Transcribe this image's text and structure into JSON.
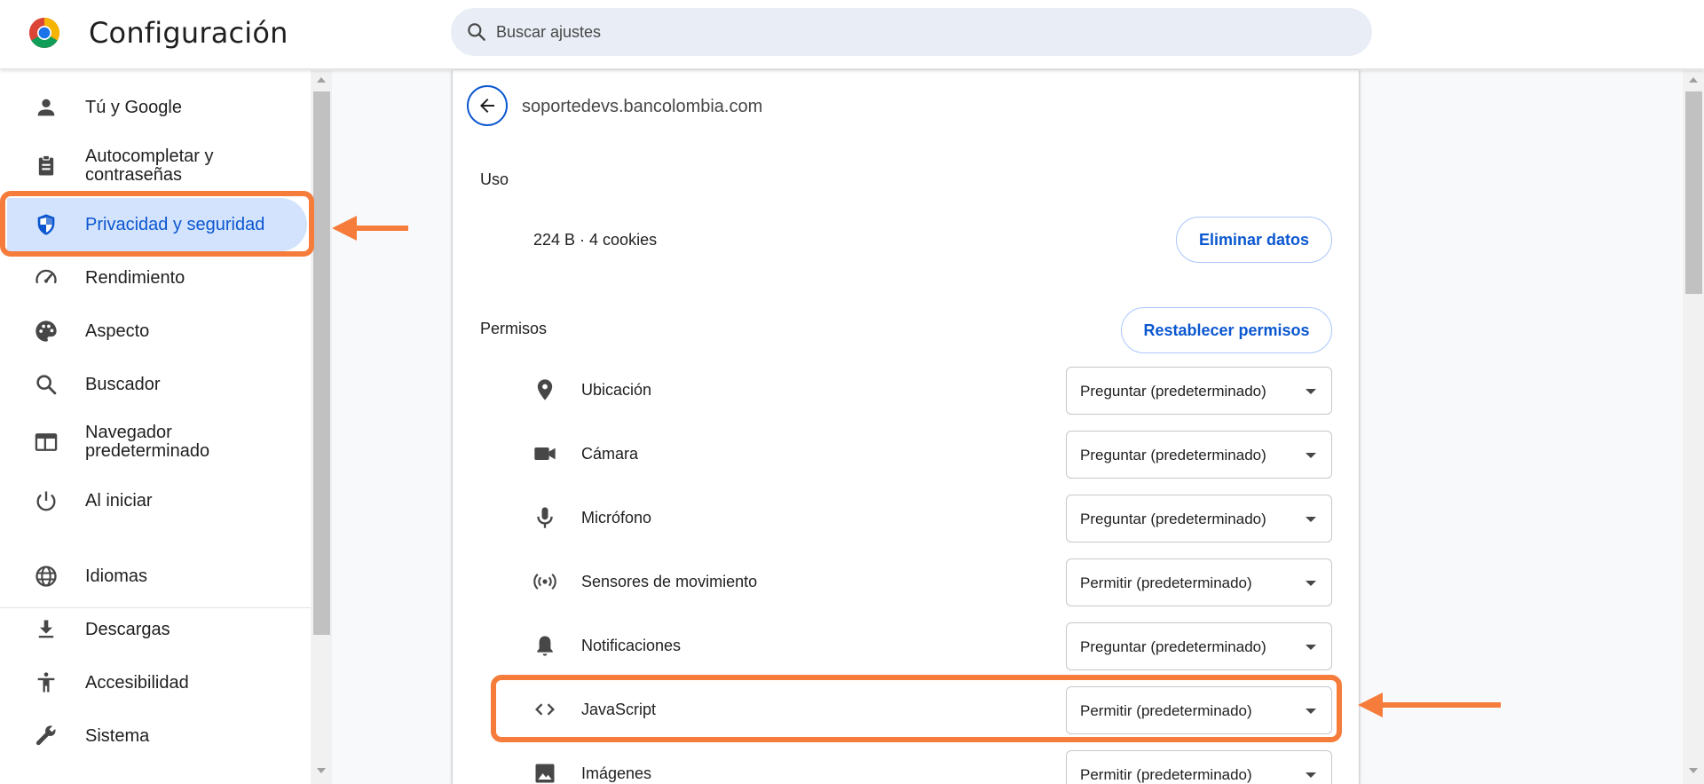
{
  "header": {
    "title": "Configuración",
    "search_placeholder": "Buscar ajustes"
  },
  "sidebar": {
    "items": [
      {
        "label": "Tú y Google",
        "icon": "person-icon",
        "active": false
      },
      {
        "label": "Autocompletar y contraseñas",
        "icon": "clipboard-icon",
        "active": false
      },
      {
        "label": "Privacidad y seguridad",
        "icon": "shield-icon",
        "active": true
      },
      {
        "label": "Rendimiento",
        "icon": "speedometer-icon",
        "active": false
      },
      {
        "label": "Aspecto",
        "icon": "palette-icon",
        "active": false
      },
      {
        "label": "Buscador",
        "icon": "search-icon",
        "active": false
      },
      {
        "label": "Navegador predeterminado",
        "icon": "browser-icon",
        "active": false
      },
      {
        "label": "Al iniciar",
        "icon": "power-icon",
        "active": false
      },
      {
        "label": "Idiomas",
        "icon": "globe-icon",
        "active": false
      },
      {
        "label": "Descargas",
        "icon": "download-icon",
        "active": false
      },
      {
        "label": "Accesibilidad",
        "icon": "accessibility-icon",
        "active": false
      },
      {
        "label": "Sistema",
        "icon": "wrench-icon",
        "active": false
      }
    ]
  },
  "site": {
    "title": "soportedevs.bancolombia.com",
    "usage_heading": "Uso",
    "usage_text": "224 B · 4 cookies",
    "delete_button": "Eliminar datos",
    "permissions_heading": "Permisos",
    "reset_button": "Restablecer permisos"
  },
  "permissions": [
    {
      "label": "Ubicación",
      "icon": "location-pin-icon",
      "value": "Preguntar (predeterminado)"
    },
    {
      "label": "Cámara",
      "icon": "camera-icon",
      "value": "Preguntar (predeterminado)"
    },
    {
      "label": "Micrófono",
      "icon": "microphone-icon",
      "value": "Preguntar (predeterminado)"
    },
    {
      "label": "Sensores de movimiento",
      "icon": "motion-sensor-icon",
      "value": "Permitir (predeterminado)"
    },
    {
      "label": "Notificaciones",
      "icon": "bell-icon",
      "value": "Preguntar (predeterminado)"
    },
    {
      "label": "JavaScript",
      "icon": "code-icon",
      "value": "Permitir (predeterminado)"
    },
    {
      "label": "Imágenes",
      "icon": "image-icon",
      "value": "Permitir (predeterminado)"
    }
  ],
  "colors": {
    "accent": "#0b57d0",
    "active_nav_bg": "#d3e3fd",
    "annotation": "#f57c3a"
  }
}
